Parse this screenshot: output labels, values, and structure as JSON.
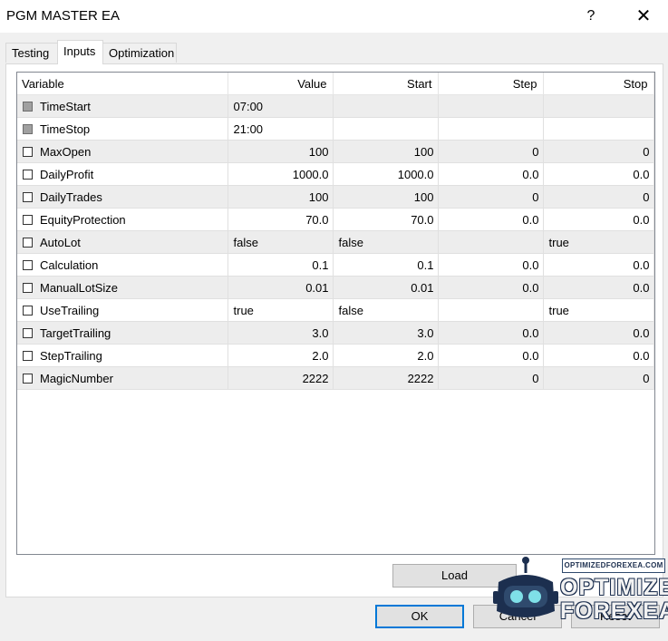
{
  "window": {
    "title": "PGM MASTER EA",
    "help_glyph": "?",
    "close_glyph": "✕"
  },
  "tabs": [
    {
      "label": "Testing"
    },
    {
      "label": "Inputs",
      "active": true
    },
    {
      "label": "Optimization"
    }
  ],
  "table": {
    "headers": [
      "Variable",
      "Value",
      "Start",
      "Step",
      "Stop"
    ],
    "rows": [
      {
        "name": "TimeStart",
        "checkbox": "grey",
        "value": "07:00",
        "start": "",
        "step": "",
        "stop": ""
      },
      {
        "name": "TimeStop",
        "checkbox": "grey",
        "value": "21:00",
        "start": "",
        "step": "",
        "stop": ""
      },
      {
        "name": "MaxOpen",
        "checkbox": "unchecked",
        "value": "100",
        "start": "100",
        "step": "0",
        "stop": "0"
      },
      {
        "name": "DailyProfit",
        "checkbox": "unchecked",
        "value": "1000.0",
        "start": "1000.0",
        "step": "0.0",
        "stop": "0.0"
      },
      {
        "name": "DailyTrades",
        "checkbox": "unchecked",
        "value": "100",
        "start": "100",
        "step": "0",
        "stop": "0"
      },
      {
        "name": "EquityProtection",
        "checkbox": "unchecked",
        "value": "70.0",
        "start": "70.0",
        "step": "0.0",
        "stop": "0.0"
      },
      {
        "name": "AutoLot",
        "checkbox": "unchecked",
        "value": "false",
        "start": "false",
        "step": "",
        "stop": "true"
      },
      {
        "name": "Calculation",
        "checkbox": "unchecked",
        "value": "0.1",
        "start": "0.1",
        "step": "0.0",
        "stop": "0.0"
      },
      {
        "name": "ManualLotSize",
        "checkbox": "unchecked",
        "value": "0.01",
        "start": "0.01",
        "step": "0.0",
        "stop": "0.0"
      },
      {
        "name": "UseTrailing",
        "checkbox": "unchecked",
        "value": "true",
        "start": "false",
        "step": "",
        "stop": "true"
      },
      {
        "name": "TargetTrailing",
        "checkbox": "unchecked",
        "value": "3.0",
        "start": "3.0",
        "step": "0.0",
        "stop": "0.0"
      },
      {
        "name": "StepTrailing",
        "checkbox": "unchecked",
        "value": "2.0",
        "start": "2.0",
        "step": "0.0",
        "stop": "0.0"
      },
      {
        "name": "MagicNumber",
        "checkbox": "unchecked",
        "value": "2222",
        "start": "2222",
        "step": "0",
        "stop": "0"
      }
    ]
  },
  "buttons": {
    "load": "Load",
    "ok": "OK",
    "cancel": "Cancel",
    "reset": "Reset"
  },
  "watermark": {
    "url": "OPTIMIZEDFOREXEA.COM",
    "line1": "OPTIMIZED",
    "line2": "FOREXEA"
  },
  "colors": {
    "focus_border": "#0078d7",
    "row_alt": "#ededed",
    "watermark_navy": "#1c2f4f"
  }
}
